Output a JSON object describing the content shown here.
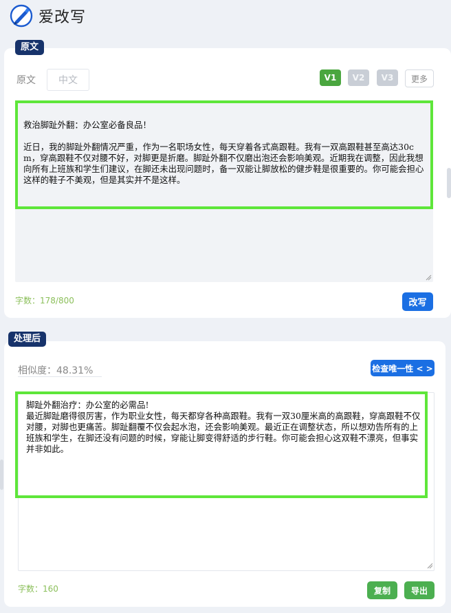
{
  "app": {
    "title": "爱改写",
    "logo_icon": "pen-circle-icon"
  },
  "original": {
    "section_label": "原文",
    "field_label": "原文",
    "language_placeholder": "中文",
    "versions": [
      "V1",
      "V2",
      "V3"
    ],
    "active_version": "V1",
    "more_label": "更多",
    "text": "救治脚趾外翻：办公室必备良品！\n\n近日，我的脚趾外翻情况严重，作为一名职场女性，每天穿着各式高跟鞋。我有一双高跟鞋甚至高达30cm，穿高跟鞋不仅对腰不好，对脚更是折磨。脚趾外翻不仅磨出泡还会影响美观。近期我在调整，因此我想向所有上班族和学生们建议，在脚还未出现问题时，备一双能让脚放松的健步鞋是很重要的。你可能会担心这样的鞋子不美观，但是其实并不是这样。",
    "char_count": "字数：178/800",
    "rewrite_button": "改写"
  },
  "processed": {
    "section_label": "处理后",
    "similarity_label": "相似度：48.31%",
    "check_button": "检查唯一性 < >",
    "text": "脚趾外翻治疗：办公室的必需品!\n最近脚趾磨得很厉害，作为职业女性，每天都穿各种高跟鞋。我有一双30厘米高的高跟鞋，穿高跟鞋不仅对腰，对脚也更痛苦。脚趾翻覆不仅会起水泡，还会影响美观。最近正在调整状态，所以想劝告所有的上班族和学生，在脚还没有问题的时候，穿能让脚变得舒适的步行鞋。你可能会担心这双鞋不漂亮，但事实并非如此。",
    "char_count": "字数：160",
    "copy_button": "复制",
    "export_button": "导出"
  },
  "colors": {
    "brand_navy": "#17336b",
    "primary_blue": "#1b6fe3",
    "green": "#4caf50",
    "highlight_green": "#5ee63a"
  }
}
